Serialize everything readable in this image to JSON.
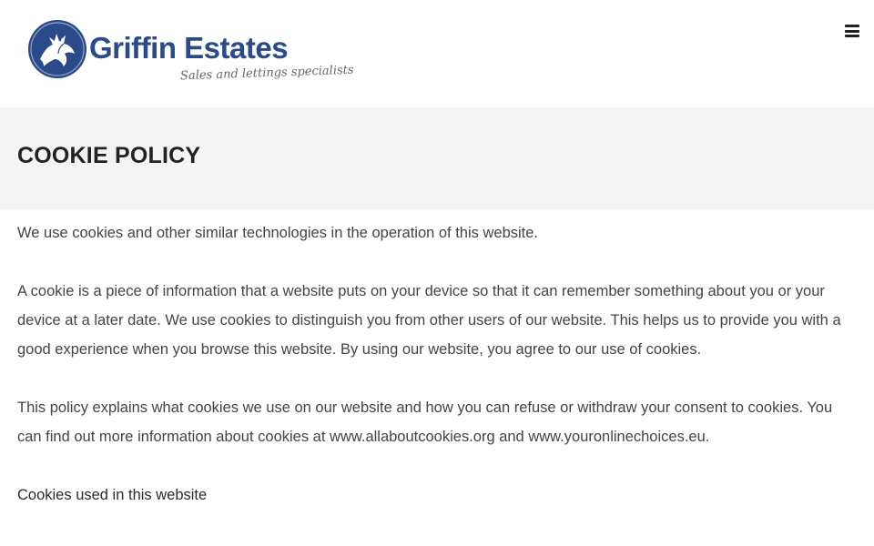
{
  "header": {
    "logo_name": "Griffin Estates",
    "logo_tagline": "Sales and lettings specialists",
    "brand_color": "#2a4a8a",
    "menu_icon": "hamburger-menu-icon"
  },
  "page": {
    "title": "COOKIE POLICY"
  },
  "content": {
    "paragraphs": [
      "We use cookies and other similar technologies in the operation of this website.",
      "A cookie is a piece of information that a website puts on your device so that it can remember something about you or your device at a later date. We use cookies to distinguish you from other users of our website. This helps us to provide you with a good experience when you browse this website. By using our website, you agree to our use of cookies.",
      "This policy explains what cookies we use on our website and how you can refuse or withdraw your consent to cookies. You can find out more information about cookies at www.allaboutcookies.org and www.youronlinechoices.eu."
    ],
    "subheading": "Cookies used in this website"
  }
}
